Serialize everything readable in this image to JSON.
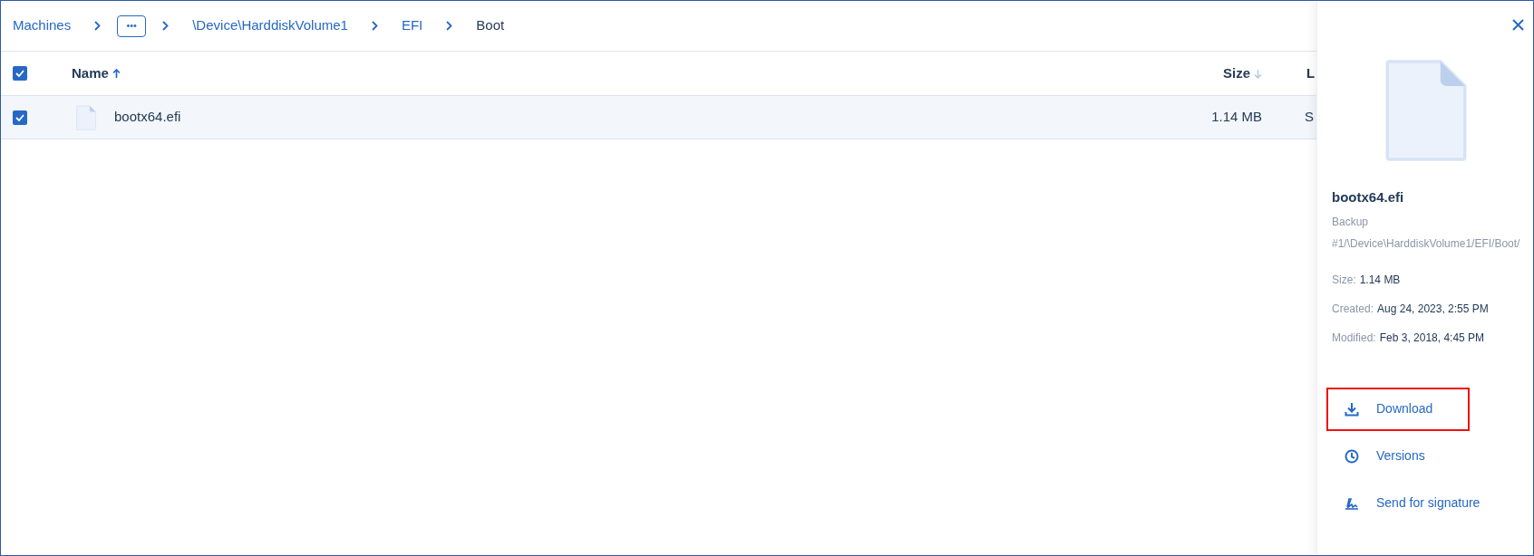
{
  "breadcrumb": [
    {
      "kind": "link",
      "label": "Machines"
    },
    {
      "kind": "more",
      "label": "•••"
    },
    {
      "kind": "link",
      "label": "\\Device\\HarddiskVolume1"
    },
    {
      "kind": "link",
      "label": "EFI"
    },
    {
      "kind": "current",
      "label": "Boot"
    }
  ],
  "table": {
    "select_all": {
      "checked": true
    },
    "columns": [
      {
        "label": "Name",
        "sorted": true
      },
      {
        "label": "Size",
        "sorted": false
      },
      {
        "label": "L"
      }
    ],
    "rows": [
      {
        "checked": true,
        "selected": true,
        "name": "bootx64.efi",
        "size": "1.14 MB",
        "column_3": "S"
      }
    ]
  },
  "details": {
    "name": "bootx64.efi",
    "source": "Backup",
    "path": "#1/\\Device\\HarddiskVolume1/EFI/Boot/",
    "fields": [
      {
        "label": "Size:",
        "value": "1.14 MB"
      },
      {
        "label": "Created:",
        "value": "Aug 24, 2023, 2:55 PM"
      },
      {
        "label": "Modified:",
        "value": "Feb 3, 2018, 4:45 PM"
      }
    ],
    "actions": [
      {
        "kind": "download",
        "label": "Download",
        "highlighted": true
      },
      {
        "kind": "versions",
        "label": "Versions",
        "highlighted": false
      },
      {
        "kind": "signature",
        "label": "Send for signature",
        "highlighted": false
      }
    ]
  }
}
